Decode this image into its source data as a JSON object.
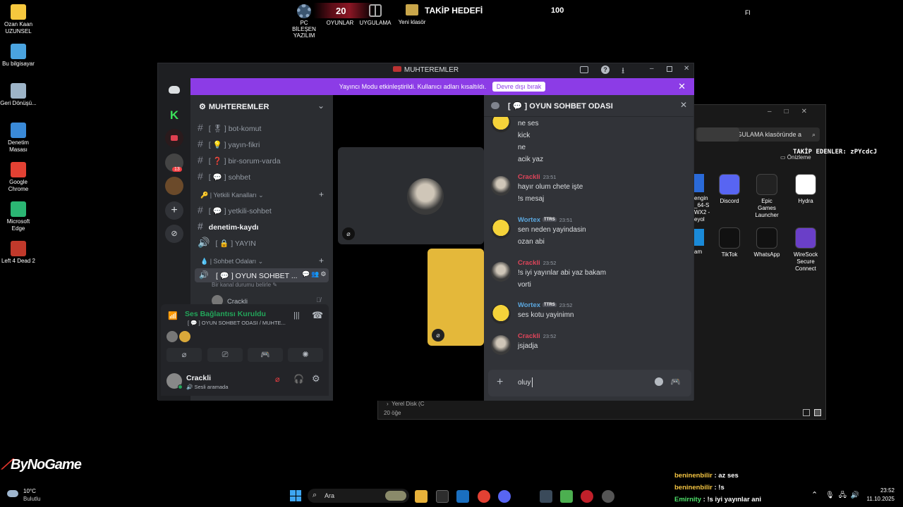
{
  "desktop": {
    "icons": [
      {
        "label": "Ozan Kaan UZUNSEL",
        "color": "#f6c83e"
      },
      {
        "label": "Bu bilgisayar",
        "color": "#4aa3df"
      },
      {
        "label": "Geri Dönüşü...",
        "color": "#9db4c8"
      },
      {
        "label": "Denetim Masası",
        "color": "#3a8ad8"
      },
      {
        "label": "Google Chrome",
        "color": "#e24133"
      },
      {
        "label": "Microsoft Edge",
        "color": "#2bb673"
      },
      {
        "label": "Left 4 Dead 2",
        "color": "#c0392b"
      }
    ],
    "top_widgets": {
      "pc_label": "PC BİLEŞEN YAZILIM",
      "games_count": "20",
      "games_label": "OYUNLAR",
      "app_label": "UYGULAMA",
      "folder_label": "Yeni klasör",
      "goal_label": "TAKİP HEDEFİ",
      "goal_value": "100",
      "corner_text": "Fl"
    },
    "bynogame": "ByNoGame",
    "followers_ticker": "TAKİP EDENLER: zPYcdcJ"
  },
  "explorer": {
    "search_placeholder": "UYGULAMA klasöründe a",
    "preview_label": "Önizleme",
    "apps": [
      {
        "label": "Discord",
        "color": "#5865f2"
      },
      {
        "label": "Epic Games Launcher",
        "color": "#222222"
      },
      {
        "label": "Hydra",
        "color": "#ffffff"
      },
      {
        "label": "TikTok",
        "color": "#111111"
      },
      {
        "label": "WhatsApp",
        "color": "#111111"
      },
      {
        "label": "WireSock Secure Connect",
        "color": "#6a3fc8"
      }
    ],
    "partial_labels": [
      "engin",
      "_64-S",
      "WX2 -",
      "eyol",
      "am"
    ],
    "tree_item": "Yerel Disk (C",
    "status": "20 öğe"
  },
  "discord": {
    "window_title": "MUHTEREMLER",
    "banner_text": "Yayıncı Modu etkinleştirildi. Kullanıcı adları kısaltıldı.",
    "banner_button": "Devre dışı bırak",
    "server_name": "MUHTEREMLER",
    "rail_badge": "13",
    "channels": [
      {
        "icon": "#",
        "label": "[ 🎖 ] bot-komut"
      },
      {
        "icon": "#",
        "label": "[ 💡 ] yayın-fikri"
      },
      {
        "icon": "#",
        "label": "[ ❓ ] bir-sorum-varda"
      },
      {
        "icon": "#",
        "label": "[ 💬 ] sohbet"
      }
    ],
    "category_yetkili": "🔑 | Yetkili Kanalları",
    "yetkili_channels": [
      {
        "icon": "#",
        "label": "[ 💬 ] yetkili-sohbet"
      },
      {
        "icon": "#",
        "label": "denetim-kaydı"
      },
      {
        "icon": "🔊",
        "label": "[ 🔒 ] YAYIN"
      }
    ],
    "category_sohbet": "💧 | Sohbet Odaları",
    "voice_channel": "[ 💬 ] OYUN SOHBET ...",
    "voice_status_hint": "Bir kanal durumu belirle",
    "voice_member": "Crackli",
    "connection_title": "Ses Bağlantısı Kuruldu",
    "connection_sub": "[ 💬 ] OYUN SOHBET ODASI / MUHTE...",
    "username": "Crackli",
    "user_status": "Sesli aramada",
    "thread_title": "[ 💬 ] OYUN SOHBET ODASI",
    "messages": [
      {
        "author": "",
        "time": "",
        "tag": "",
        "author_color": "#dbdee1",
        "avatar": "duck",
        "lines": [
          "ne ses",
          "kick",
          "ne",
          "acik yaz"
        ]
      },
      {
        "author": "Crackli",
        "time": "23:51",
        "tag": "",
        "author_color": "#e0455a",
        "avatar": "person",
        "lines": [
          "hayır olum chete işte",
          "!s mesaj"
        ]
      },
      {
        "author": "Wortex",
        "time": "23:51",
        "tag": "TTRS",
        "author_color": "#5ba8e0",
        "avatar": "duck",
        "lines": [
          "sen neden yayindasin",
          "ozan abi"
        ]
      },
      {
        "author": "Crackli",
        "time": "23:52",
        "tag": "",
        "author_color": "#e0455a",
        "avatar": "person",
        "lines": [
          "!s iyi yayınlar abi yaz bakam",
          "vorti"
        ]
      },
      {
        "author": "Wortex",
        "time": "23:52",
        "tag": "TTRS",
        "author_color": "#5ba8e0",
        "avatar": "duck",
        "lines": [
          "ses kotu yayinimn"
        ]
      },
      {
        "author": "Crackli",
        "time": "23:52",
        "tag": "",
        "author_color": "#e0455a",
        "avatar": "person",
        "lines": [
          "jsjadja"
        ]
      }
    ],
    "input_value": "oluy"
  },
  "chat_overlay": [
    {
      "user": "beninenbilir",
      "text": " : az ses",
      "color": "#f5c542"
    },
    {
      "user": "beninenbilir",
      "text": " : !s",
      "color": "#f5c542"
    },
    {
      "user": "Emirnity",
      "text": " : !s iyi yayınlar ani",
      "color": "#4ee06a"
    }
  ],
  "taskbar": {
    "weather_temp": "10°C",
    "weather_desc": "Bulutlu",
    "search_label": "Ara",
    "clock_time": "23:52",
    "clock_date": "11.10.2025"
  }
}
